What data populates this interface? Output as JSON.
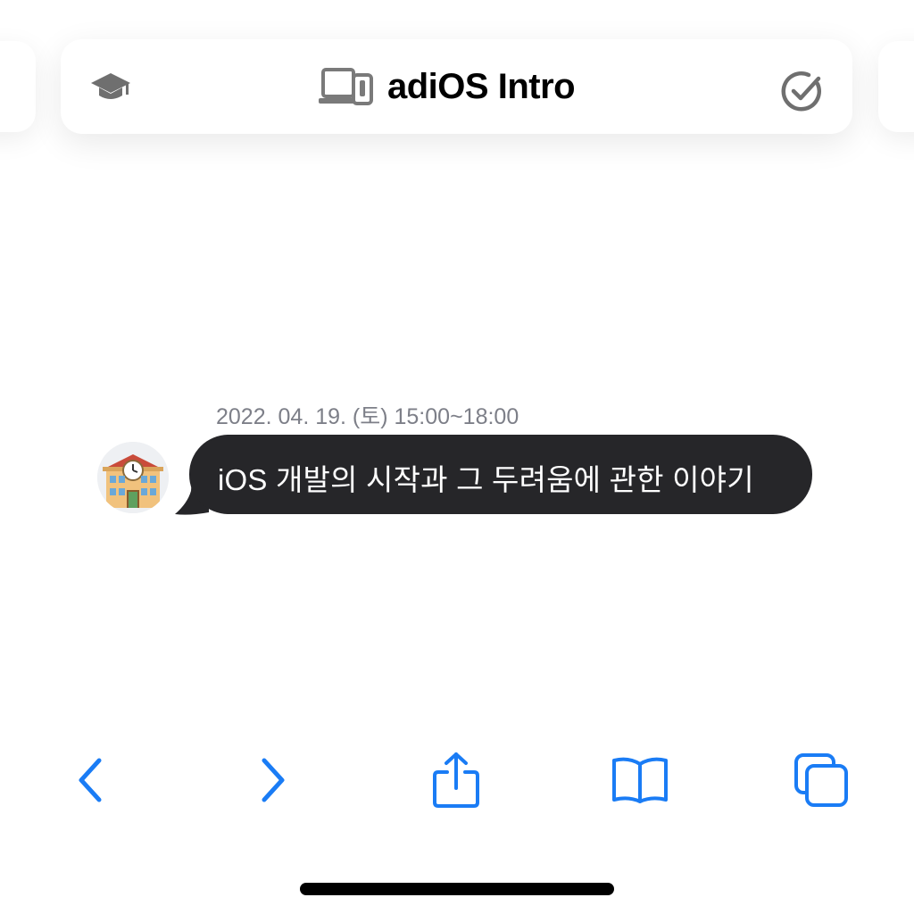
{
  "header": {
    "title": "adiOS Intro",
    "left_icon": "graduation-cap-icon",
    "title_icon": "devices-icon",
    "right_icon": "checkmark-circle-icon"
  },
  "chat": {
    "date_label": "2022. 04. 19. (토) 15:00~18:00",
    "avatar_icon": "school-building-icon",
    "message": "iOS 개발의 시작과 그 두려움에 관한 이야기"
  },
  "toolbar": {
    "buttons": [
      {
        "icon": "back-chevron-icon"
      },
      {
        "icon": "forward-chevron-icon"
      },
      {
        "icon": "share-icon"
      },
      {
        "icon": "bookmarks-book-icon"
      },
      {
        "icon": "tabs-icon"
      }
    ]
  },
  "colors": {
    "accent": "#1A7CF5",
    "bubble": "#262629",
    "date_text": "#7D7F88",
    "icon_gray": "#6F6F6F"
  }
}
